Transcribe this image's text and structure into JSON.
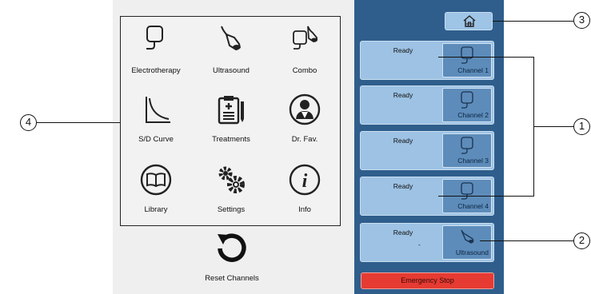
{
  "menu": {
    "items": [
      {
        "label": "Electrotherapy",
        "icon": "electrode-pad-icon"
      },
      {
        "label": "Ultrasound",
        "icon": "ultrasound-probe-icon"
      },
      {
        "label": "Combo",
        "icon": "combo-icon"
      },
      {
        "label": "S/D Curve",
        "icon": "sd-curve-icon"
      },
      {
        "label": "Treatments",
        "icon": "clipboard-icon"
      },
      {
        "label": "Dr. Fav.",
        "icon": "doctor-icon"
      },
      {
        "label": "Library",
        "icon": "book-icon"
      },
      {
        "label": "Settings",
        "icon": "gears-icon"
      },
      {
        "label": "Info",
        "icon": "info-icon"
      }
    ]
  },
  "reset": {
    "label": "Reset Channels",
    "icon": "reset-icon"
  },
  "home": {
    "icon": "home-icon"
  },
  "channels": [
    {
      "status": "Ready",
      "name": "Channel 1"
    },
    {
      "status": "Ready",
      "name": "Channel 2"
    },
    {
      "status": "Ready",
      "name": "Channel 3"
    },
    {
      "status": "Ready",
      "name": "Channel 4"
    },
    {
      "status": "Ready",
      "value": "-",
      "name": "Ultrasound"
    }
  ],
  "emergency": {
    "label": "Emergency Stop"
  },
  "callouts": {
    "c1": "1",
    "c2": "2",
    "c3": "3",
    "c4": "4"
  },
  "colors": {
    "panel": "#2f5e8c",
    "channel": "#9dc2e4",
    "emergency": "#e63b32"
  }
}
